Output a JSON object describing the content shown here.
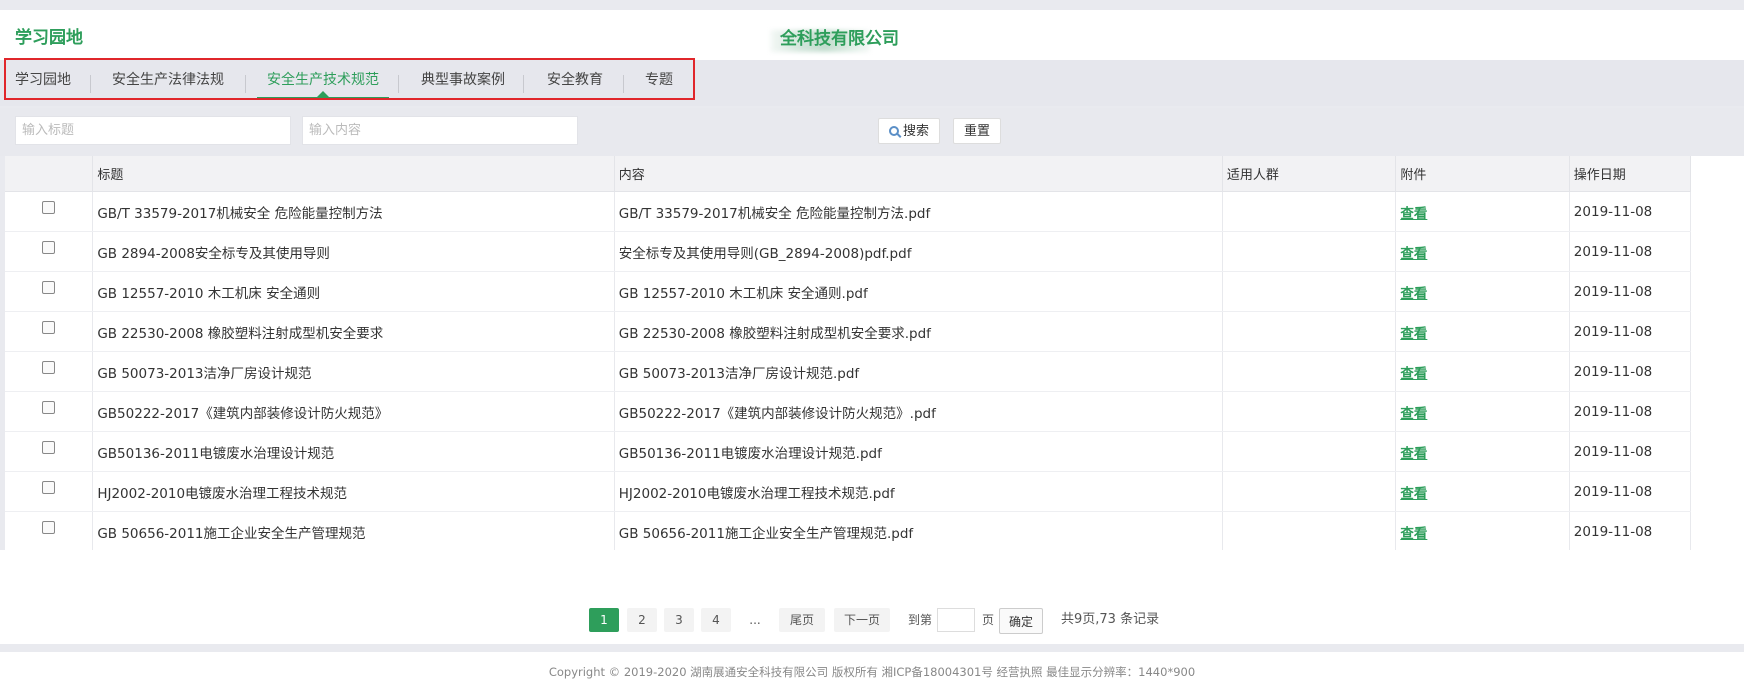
{
  "header": {
    "brand": "学习园地",
    "company": "全科技有限公司"
  },
  "nav": {
    "items": [
      {
        "label": "学习园地"
      },
      {
        "label": "安全生产法律法规"
      },
      {
        "label": "安全生产技术规范"
      },
      {
        "label": "典型事故案例"
      },
      {
        "label": "安全教育"
      },
      {
        "label": "专题"
      }
    ],
    "active": "安全生产技术规范"
  },
  "search": {
    "title_placeholder": "输入标题",
    "content_placeholder": "输入内容",
    "search_label": "搜索",
    "reset_label": "重置"
  },
  "table": {
    "headers": [
      "",
      "标题",
      "内容",
      "适用人群",
      "附件",
      "操作日期"
    ],
    "rows": [
      {
        "title": "GB/T 33579-2017机械安全 危险能量控制方法",
        "content": "GB/T 33579-2017机械安全 危险能量控制方法.pdf",
        "audience": "",
        "attachment": "查看",
        "date": "2019-11-08"
      },
      {
        "title": "GB 2894-2008安全标专及其使用导则",
        "content": "安全标专及其使用导则(GB_2894-2008)pdf.pdf",
        "audience": "",
        "attachment": "查看",
        "date": "2019-11-08"
      },
      {
        "title": "GB 12557-2010 木工机床 安全通则",
        "content": "GB 12557-2010 木工机床 安全通则.pdf",
        "audience": "",
        "attachment": "查看",
        "date": "2019-11-08"
      },
      {
        "title": "GB 22530-2008 橡胶塑料注射成型机安全要求",
        "content": "GB 22530-2008 橡胶塑料注射成型机安全要求.pdf",
        "audience": "",
        "attachment": "查看",
        "date": "2019-11-08"
      },
      {
        "title": "GB 50073-2013洁净厂房设计规范",
        "content": "GB 50073-2013洁净厂房设计规范.pdf",
        "audience": "",
        "attachment": "查看",
        "date": "2019-11-08"
      },
      {
        "title": "GB50222-2017《建筑内部装修设计防火规范》",
        "content": "GB50222-2017《建筑内部装修设计防火规范》.pdf",
        "audience": "",
        "attachment": "查看",
        "date": "2019-11-08"
      },
      {
        "title": "GB50136-2011电镀废水治理设计规范",
        "content": "GB50136-2011电镀废水治理设计规范.pdf",
        "audience": "",
        "attachment": "查看",
        "date": "2019-11-08"
      },
      {
        "title": "HJ2002-2010电镀废水治理工程技术规范",
        "content": "HJ2002-2010电镀废水治理工程技术规范.pdf",
        "audience": "",
        "attachment": "查看",
        "date": "2019-11-08"
      },
      {
        "title": "GB 50656-2011施工企业安全生产管理规范",
        "content": "GB 50656-2011施工企业安全生产管理规范.pdf",
        "audience": "",
        "attachment": "查看",
        "date": "2019-11-08"
      }
    ]
  },
  "pager": {
    "pages": [
      "1",
      "2",
      "3",
      "4"
    ],
    "current": "1",
    "ellipsis": "...",
    "last_label": "尾页",
    "next_label": "下一页",
    "goto_label": "到第",
    "page_unit": "页",
    "confirm_label": "确定",
    "summary": "共9页,73 条记录"
  },
  "footer": {
    "text": "Copyright © 2019-2020 湖南展通安全科技有限公司 版权所有 湘ICP备18004301号 经营执照   最佳显示分辨率：1440*900"
  },
  "colors": {
    "accent": "#2e9e5b",
    "highlight_border": "#e0262b"
  }
}
